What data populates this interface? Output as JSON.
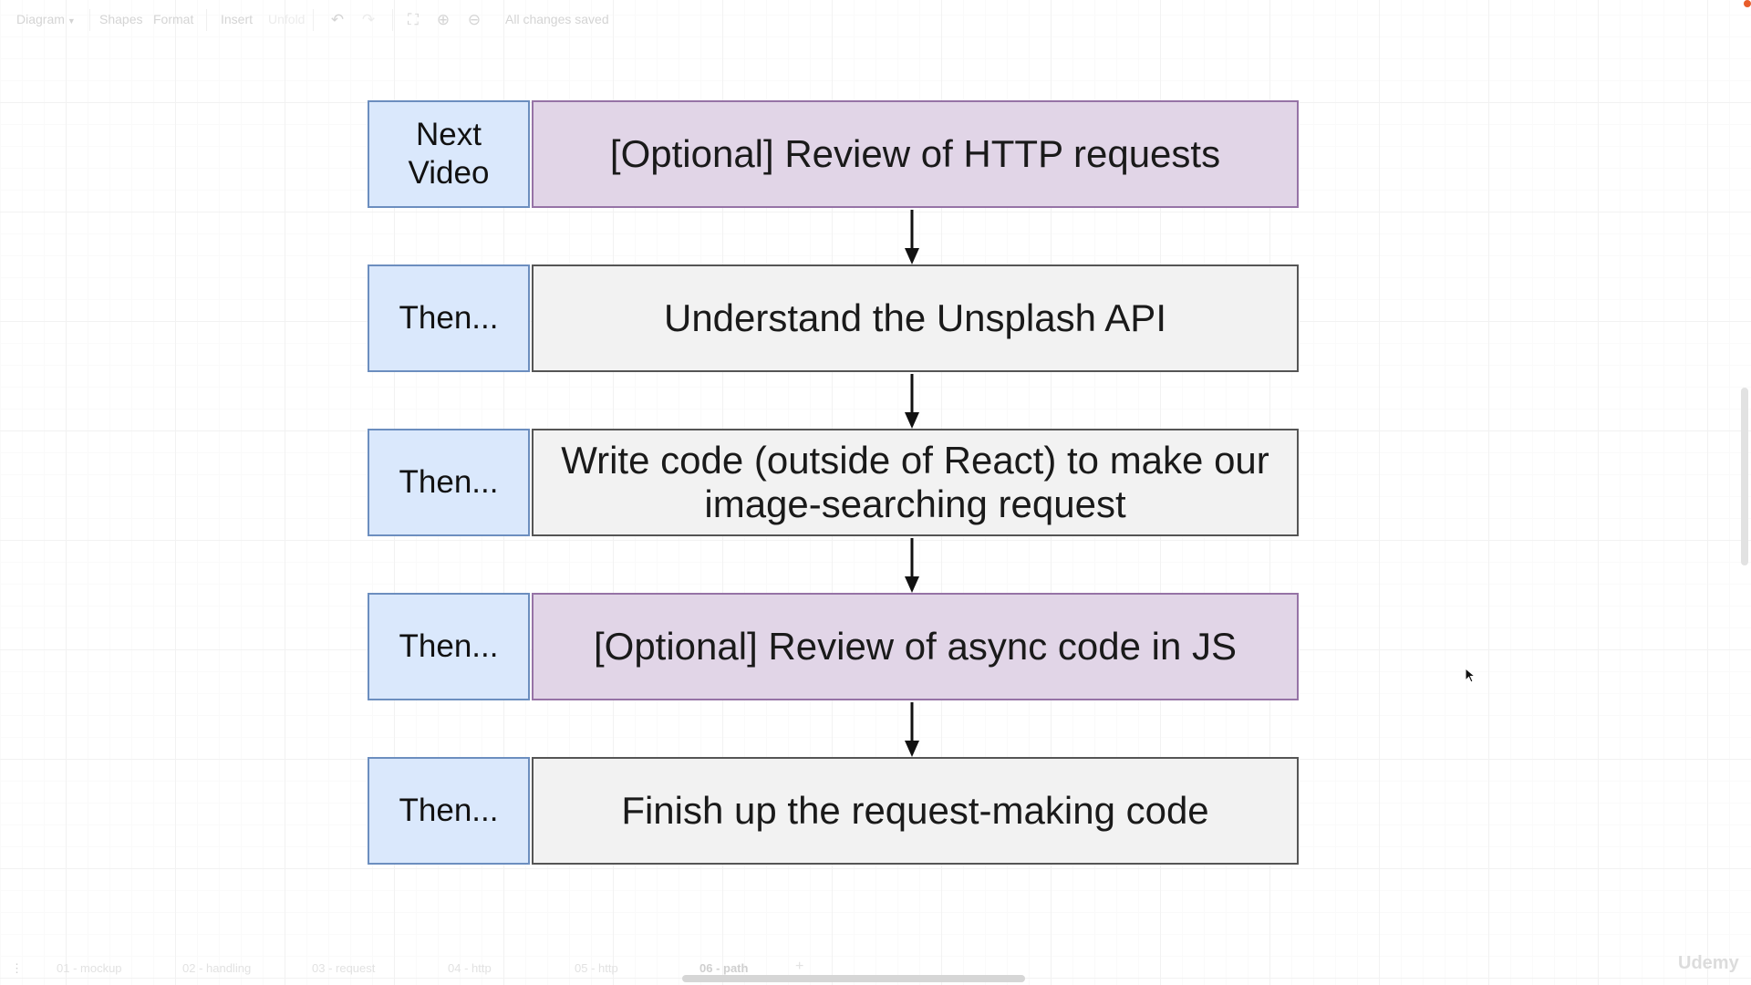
{
  "toolbar": {
    "diagram_menu": "Diagram",
    "shapes": "Shapes",
    "format": "Format",
    "insert": "Insert",
    "unfold": "Unfold",
    "status": "All changes saved"
  },
  "diagram": {
    "rows": [
      {
        "label": "Next Video",
        "text": "[Optional] Review of HTTP requests",
        "style": "purple"
      },
      {
        "label": "Then...",
        "text": "Understand the Unsplash API",
        "style": "grey"
      },
      {
        "label": "Then...",
        "text": "Write code (outside of React) to make our image-searching request",
        "style": "grey"
      },
      {
        "label": "Then...",
        "text": "[Optional] Review of async code in JS",
        "style": "purple"
      },
      {
        "label": "Then...",
        "text": "Finish up the request-making code",
        "style": "grey"
      }
    ]
  },
  "page_tabs": {
    "items": [
      "01 - mockup",
      "02 - handling",
      "03 - request",
      "04 - http",
      "05 - http",
      "06 - path"
    ],
    "active": "06 - path",
    "add_label": "+"
  },
  "watermark": "Udemy",
  "colors": {
    "label_fill": "#dae8fc",
    "label_stroke": "#6c8ebf",
    "optional_fill": "#e1d5e7",
    "optional_stroke": "#9673a6",
    "step_fill": "#f2f2f2",
    "step_stroke": "#555555"
  }
}
